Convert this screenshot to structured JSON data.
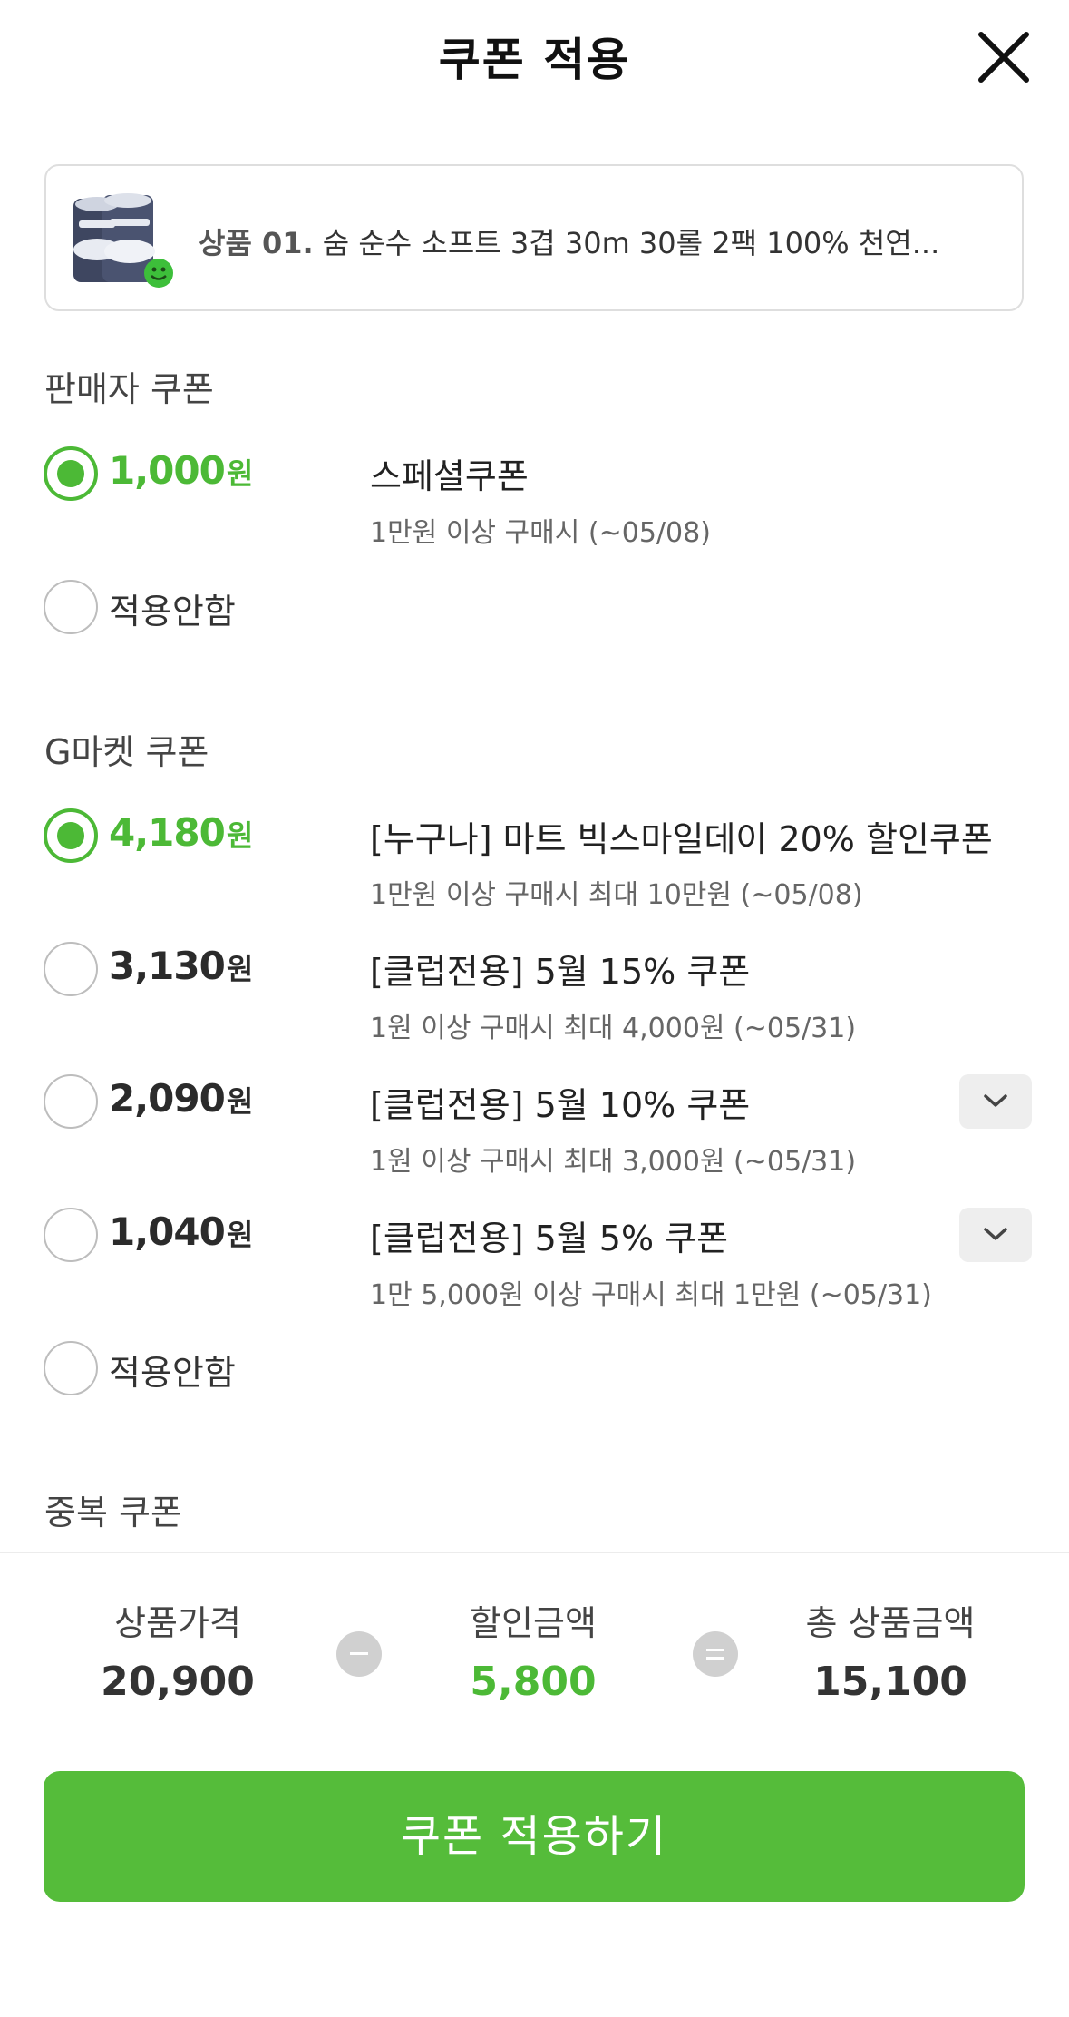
{
  "header": {
    "title": "쿠폰 적용"
  },
  "product": {
    "number": "상품 01.",
    "name": "숨 순수 소프트 3겹 30m 30롤 2팩 100% 천연..."
  },
  "seller_section": {
    "title": "판매자 쿠폰",
    "coupons": [
      {
        "amount": "1,000",
        "unit": "원",
        "name": "스페셜쿠폰",
        "condition": "1만원 이상 구매시 (~05/08)",
        "selected": true
      }
    ],
    "none_label": "적용안함"
  },
  "gmarket_section": {
    "title": "G마켓 쿠폰",
    "coupons": [
      {
        "amount": "4,180",
        "unit": "원",
        "name": "[누구나] 마트 빅스마일데이 20% 할인쿠폰",
        "condition": "1만원 이상 구매시 최대 10만원 (~05/08)",
        "selected": true
      },
      {
        "amount": "3,130",
        "unit": "원",
        "name": "[클럽전용] 5월 15% 쿠폰",
        "condition": "1원 이상 구매시 최대 4,000원 (~05/31)",
        "selected": false
      },
      {
        "amount": "2,090",
        "unit": "원",
        "name": "[클럽전용] 5월 10% 쿠폰",
        "condition": "1원 이상 구매시 최대 3,000원 (~05/31)",
        "selected": false
      },
      {
        "amount": "1,040",
        "unit": "원",
        "name": "[클럽전용] 5월 5% 쿠폰",
        "condition": "1만 5,000원 이상 구매시 최대 1만원 (~05/31)",
        "selected": false
      }
    ],
    "none_label": "적용안함"
  },
  "duplicate_section": {
    "title": "중복 쿠폰"
  },
  "summary": {
    "price_label": "상품가격",
    "price_value": "20,900",
    "discount_label": "할인금액",
    "discount_value": "5,800",
    "total_label": "총 상품금액",
    "total_value": "15,100"
  },
  "apply_button": {
    "label": "쿠폰 적용하기"
  },
  "colors": {
    "accent": "#4cb936",
    "button": "#55bc3a"
  },
  "icons": {
    "close": "close-icon",
    "expand": "chevron-down-icon",
    "minus": "minus-icon",
    "equals": "equals-icon"
  }
}
